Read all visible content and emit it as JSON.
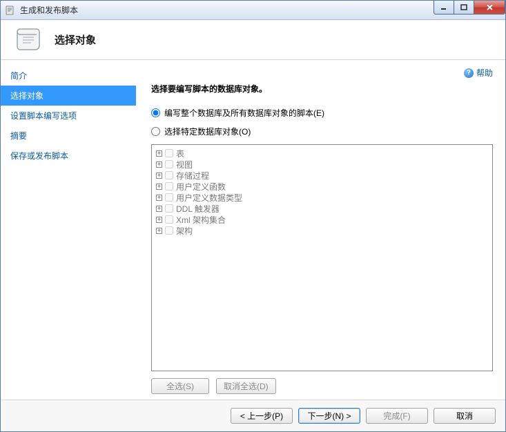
{
  "window": {
    "title": "生成和发布脚本"
  },
  "header": {
    "title": "选择对象"
  },
  "sidebar": {
    "items": [
      {
        "label": "简介",
        "selected": false
      },
      {
        "label": "选择对象",
        "selected": true
      },
      {
        "label": "设置脚本编写选项",
        "selected": false
      },
      {
        "label": "摘要",
        "selected": false
      },
      {
        "label": "保存或发布脚本",
        "selected": false
      }
    ]
  },
  "help": {
    "label": "帮助"
  },
  "main": {
    "instruction": "选择要编写脚本的数据库对象。",
    "radio_all": "编写整个数据库及所有数据库对象的脚本(E)",
    "radio_specific": "选择特定数据库对象(O)",
    "tree": [
      {
        "label": "表"
      },
      {
        "label": "视图"
      },
      {
        "label": "存储过程"
      },
      {
        "label": "用户定义函数"
      },
      {
        "label": "用户定义数据类型"
      },
      {
        "label": "DDL 触发器"
      },
      {
        "label": "Xml 架构集合"
      },
      {
        "label": "架构"
      }
    ],
    "select_all": "全选(S)",
    "deselect_all": "取消全选(D)"
  },
  "footer": {
    "prev": "< 上一步(P)",
    "next": "下一步(N) >",
    "finish": "完成(F)",
    "cancel": "取消"
  }
}
